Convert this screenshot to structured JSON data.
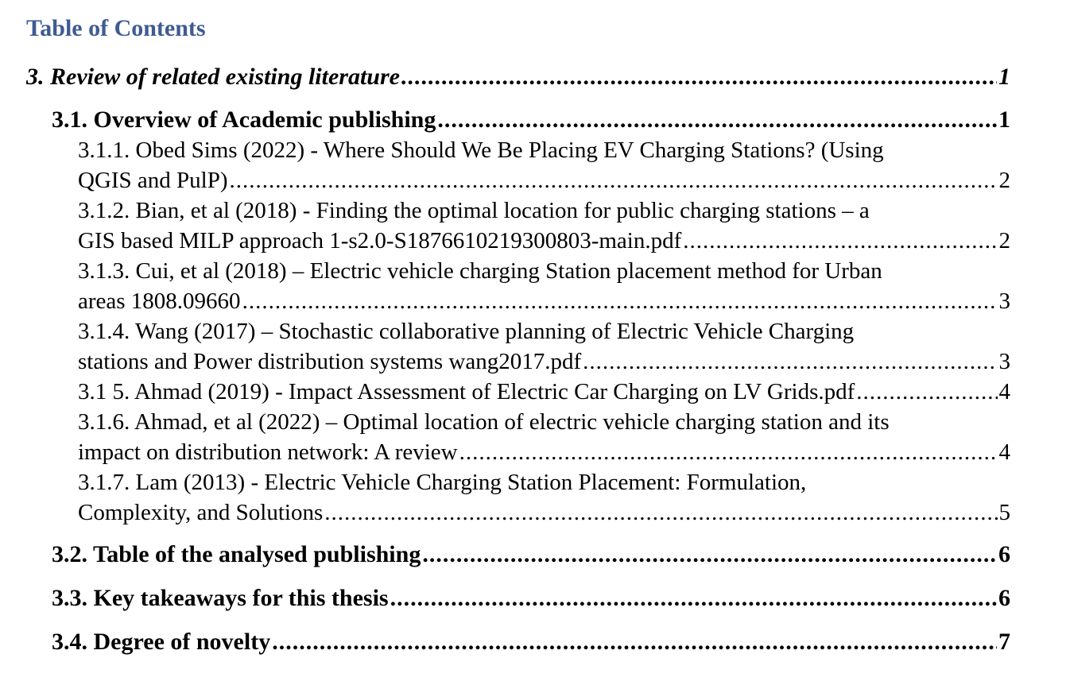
{
  "heading": "Table of Contents",
  "entries": [
    {
      "level": 1,
      "text": "3. Review of related existing literature",
      "page": "1"
    },
    {
      "level": 2,
      "text": "3.1. Overview of Academic publishing",
      "page": "1"
    },
    {
      "level": 3,
      "first": "3.1.1. Obed Sims (2022) - Where Should We Be Placing EV Charging Stations? (Using",
      "text": "QGIS and PulP)",
      "page": "2"
    },
    {
      "level": 3,
      "first": "3.1.2. Bian, et al (2018) - Finding the optimal location for public charging stations – a",
      "text": "GIS based MILP approach 1-s2.0-S1876610219300803-main.pdf",
      "page": "2"
    },
    {
      "level": 3,
      "first": "3.1.3. Cui, et al (2018) – Electric vehicle charging Station placement method for Urban",
      "text": "areas 1808.09660",
      "page": "3"
    },
    {
      "level": 3,
      "first": "3.1.4. Wang (2017) – Stochastic collaborative planning of Electric Vehicle Charging",
      "text": "stations and Power distribution systems wang2017.pdf",
      "page": "3"
    },
    {
      "level": 3,
      "text": "3.1 5. Ahmad (2019) - Impact Assessment of Electric Car Charging on LV Grids.pdf",
      "page": "4"
    },
    {
      "level": 3,
      "first": "3.1.6. Ahmad, et al (2022) – Optimal location of electric vehicle charging station and its",
      "text": "impact on distribution network: A review",
      "page": "4"
    },
    {
      "level": 3,
      "first": "3.1.7. Lam (2013) - Electric Vehicle Charging Station Placement: Formulation,",
      "text": "Complexity, and Solutions",
      "page": "5"
    },
    {
      "level": 2,
      "text": "3.2. Table of the analysed publishing",
      "page": "6"
    },
    {
      "level": 2,
      "text": "3.3. Key takeaways for this thesis",
      "page": "6"
    },
    {
      "level": 2,
      "text": "3.4. Degree of novelty",
      "page": "7"
    }
  ]
}
